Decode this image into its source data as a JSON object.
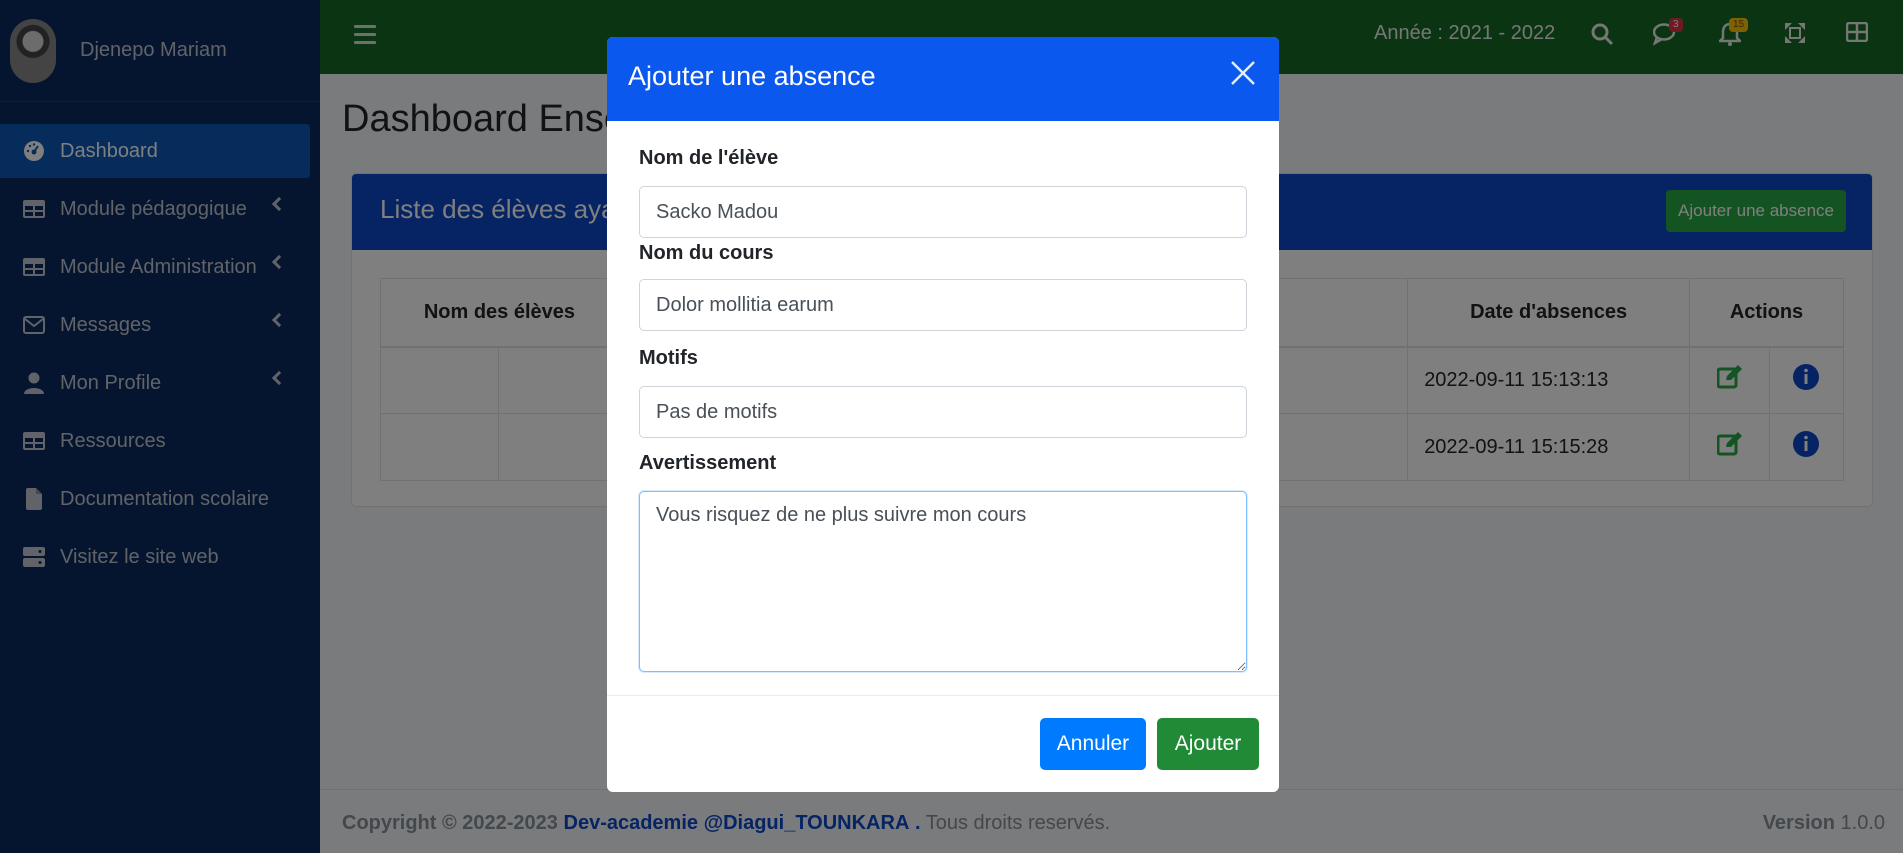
{
  "sidebar": {
    "user_name": "Djenepo Mariam",
    "items": [
      {
        "label": "Dashboard",
        "icon": "tachometer-icon",
        "active": true,
        "chevron": false
      },
      {
        "label": "Module pédagogique",
        "icon": "table-icon",
        "active": false,
        "chevron": true
      },
      {
        "label": "Module Administration",
        "icon": "table-icon",
        "active": false,
        "chevron": true
      },
      {
        "label": "Messages",
        "icon": "envelope-icon",
        "active": false,
        "chevron": true
      },
      {
        "label": "Mon Profile",
        "icon": "user-icon",
        "active": false,
        "chevron": true
      },
      {
        "label": "Ressources",
        "icon": "table-icon",
        "active": false,
        "chevron": false
      },
      {
        "label": "Documentation scolaire",
        "icon": "file-icon",
        "active": false,
        "chevron": false
      },
      {
        "label": "Visitez le site web",
        "icon": "server-icon",
        "active": false,
        "chevron": false
      }
    ]
  },
  "header": {
    "year_label": "Année : 2021 - 2022",
    "messages_badge": "3",
    "notifications_badge": "15"
  },
  "main": {
    "page_title": "Dashboard Ense",
    "card_title": "Liste des élèves ayan",
    "add_button": "Ajouter une absence",
    "table": {
      "headers": [
        "Nom des élèves",
        "Date d'absences",
        "Actions"
      ],
      "rows": [
        {
          "date": "2022-09-11 15:13:13"
        },
        {
          "date": "2022-09-11 15:15:28"
        }
      ]
    }
  },
  "footer": {
    "copyright": "Copyright © 2022-2023",
    "link": "Dev-academie @Diagui_TOUNKARA",
    "dot": ".",
    "rights": "Tous droits reservés.",
    "version_label": "Version",
    "version": "1.0.0"
  },
  "modal": {
    "title": "Ajouter une absence",
    "student_label": "Nom de l'élève",
    "student_value": "Sacko Madou",
    "course_label": "Nom du cours",
    "course_value": "Dolor mollitia earum",
    "reason_label": "Motifs",
    "reason_value": "Pas de motifs",
    "warning_label": "Avertissement",
    "warning_value": "Vous risquez de ne plus suivre mon cours",
    "cancel_button": "Annuler",
    "submit_button": "Ajouter"
  },
  "colors": {
    "sidebar_bg": "#0a2b5e",
    "header_bg": "#176925",
    "primary": "#0a58ee",
    "success": "#28a745"
  }
}
